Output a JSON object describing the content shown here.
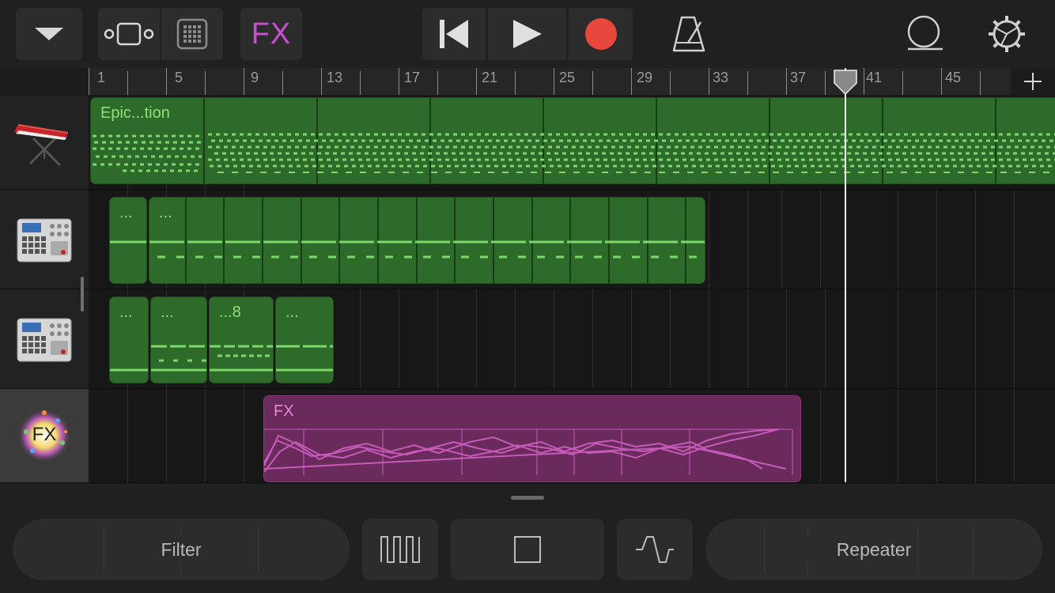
{
  "toolbar": {
    "fx_label": "FX"
  },
  "ruler": {
    "bars": [
      "1",
      "5",
      "9",
      "13",
      "17",
      "21",
      "25",
      "29",
      "33",
      "37",
      "41",
      "45"
    ]
  },
  "tracks": [
    {
      "name": "keyboard-track",
      "regions": [
        {
          "label": "Epic...tion"
        }
      ]
    },
    {
      "name": "drum-machine-track-1",
      "regions": [
        {
          "label": "..."
        },
        {
          "label": "..."
        }
      ]
    },
    {
      "name": "drum-machine-track-2",
      "regions": [
        {
          "label": "..."
        },
        {
          "label": "..."
        },
        {
          "label": "...8"
        },
        {
          "label": "..."
        }
      ]
    },
    {
      "name": "fx-track",
      "icon_text": "FX",
      "regions": [
        {
          "label": "FX"
        }
      ]
    }
  ],
  "controls": {
    "filter_label": "Filter",
    "repeater_label": "Repeater"
  },
  "colors": {
    "record": "#e8473c",
    "fx_accent": "#c94fd0",
    "region_green": "#2e6b2a",
    "region_purple": "#6a2a5c"
  }
}
